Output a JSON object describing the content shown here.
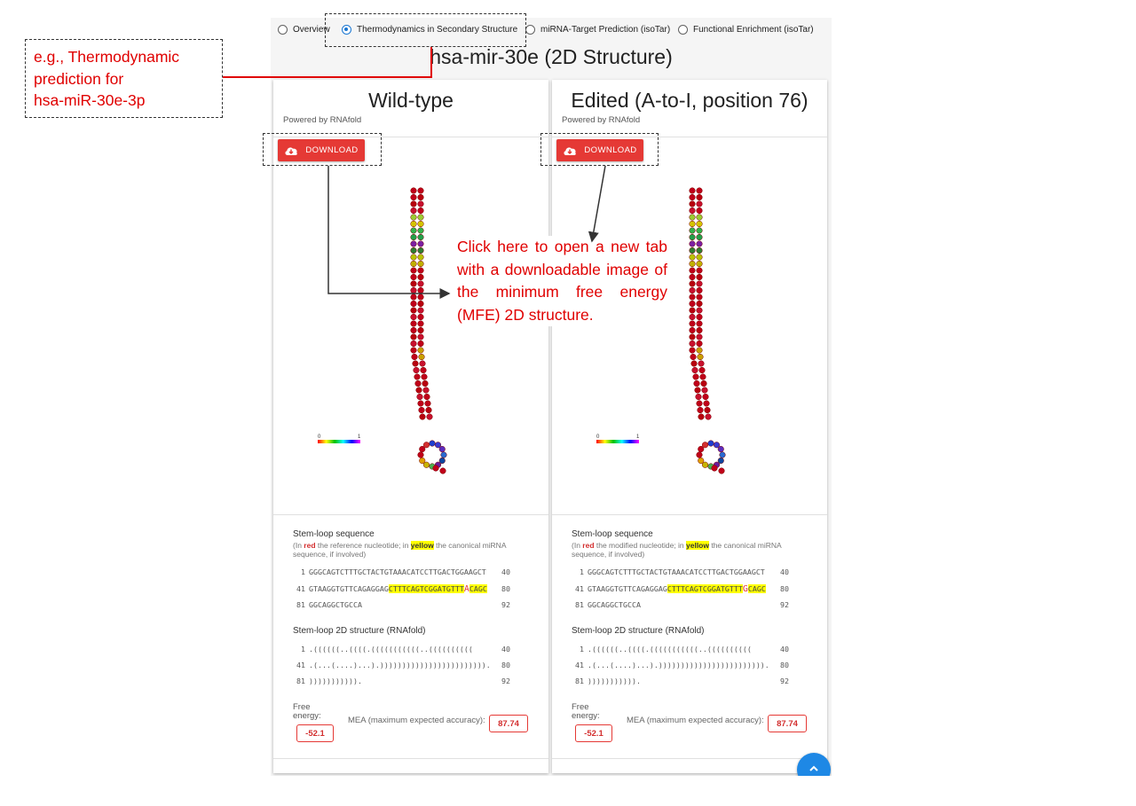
{
  "tabs": [
    {
      "label": "Overview",
      "selected": false
    },
    {
      "label": "Thermodynamics in Secondary Structure",
      "selected": true
    },
    {
      "label": "miRNA-Target Prediction (isoTar)",
      "selected": false
    },
    {
      "label": "Functional Enrichment (isoTar)",
      "selected": false
    }
  ],
  "page_title": "hsa-mir-30e (2D Structure)",
  "panels": [
    {
      "title": "Wild-type",
      "powered_by": "Powered by RNAfold",
      "download_label": "DOWNLOAD",
      "scale_min": "0",
      "scale_max": "1",
      "seq_heading": "Stem-loop sequence",
      "seq_note_pre": "(In ",
      "seq_note_red": "red",
      "seq_note_mid": " the reference nucleotide; in ",
      "seq_note_yellow": "yellow",
      "seq_note_post": " the canonical miRNA sequence, if involved)",
      "seq_lines": [
        {
          "start": "1",
          "pre": "GGGCAGTCTTTGCTACTGTAAACATCCTTGACTGGAAGCT",
          "hl1": "",
          "edit": "",
          "hl2": "",
          "end": "40"
        },
        {
          "start": "41",
          "pre": "GTAAGGTGTTCAGAGGAG",
          "hl1": "CTTTCAGTCGGATGTTT",
          "edit": "A",
          "hl2": "CAGC",
          "end": "80"
        },
        {
          "start": "81",
          "pre": "GGCAGGCTGCCA",
          "hl1": "",
          "edit": "",
          "hl2": "",
          "end": "92"
        }
      ],
      "struct_heading": "Stem-loop 2D structure (RNAfold)",
      "struct_lines": [
        {
          "start": "1",
          "text": ".((((((..((((.(((((((((((..((((((((((",
          "end": "40"
        },
        {
          "start": "41",
          "text": ".(...(....)...).)))))))))))))))))))))))).",
          "end": "80"
        },
        {
          "start": "81",
          "text": "))))))))))).",
          "end": "92"
        }
      ],
      "fe_label": "Free energy:",
      "fe_value": "-52.1",
      "mea_label": "MEA (maximum expected accuracy):",
      "mea_value": "87.74"
    },
    {
      "title": "Edited (A-to-I, position 76)",
      "powered_by": "Powered by RNAfold",
      "download_label": "DOWNLOAD",
      "scale_min": "0",
      "scale_max": "1",
      "seq_heading": "Stem-loop sequence",
      "seq_note_pre": "(In ",
      "seq_note_red": "red",
      "seq_note_mid": " the modified nucleotide; in ",
      "seq_note_yellow": "yellow",
      "seq_note_post": " the canonical miRNA sequence, if involved)",
      "seq_lines": [
        {
          "start": "1",
          "pre": "GGGCAGTCTTTGCTACTGTAAACATCCTTGACTGGAAGCT",
          "hl1": "",
          "edit": "",
          "hl2": "",
          "end": "40"
        },
        {
          "start": "41",
          "pre": "GTAAGGTGTTCAGAGGAG",
          "hl1": "CTTTCAGTCGGATGTTT",
          "edit": "G",
          "hl2": "CAGC",
          "end": "80"
        },
        {
          "start": "81",
          "pre": "GGCAGGCTGCCA",
          "hl1": "",
          "edit": "",
          "hl2": "",
          "end": "92"
        }
      ],
      "struct_heading": "Stem-loop 2D structure (RNAfold)",
      "struct_lines": [
        {
          "start": "1",
          "text": ".((((((..((((.(((((((((((..((((((((((",
          "end": "40"
        },
        {
          "start": "41",
          "text": ".(...(....)...).)))))))))))))))))))))))).",
          "end": "80"
        },
        {
          "start": "81",
          "text": "))))))))))).",
          "end": "92"
        }
      ],
      "fe_label": "Free energy:",
      "fe_value": "-52.1",
      "mea_label": "MEA (maximum expected accuracy):",
      "mea_value": "87.74"
    }
  ],
  "callout_top": [
    "e.g., Thermodynamic",
    "prediction for",
    "hsa-miR-30e-3p"
  ],
  "callout_mid": "Click here to open a new tab with a downloadable image of the minimum free energy (MFE) 2D structure.",
  "colors": {
    "annotation_red": "#e00000",
    "download_red": "#e53935",
    "radio_blue": "#1976d2",
    "highlight_yellow": "#ffff00",
    "fab_blue": "#1e88e5"
  },
  "icons": {
    "download": "cloud-download-icon",
    "scroll_top": "chevron-up-icon"
  }
}
